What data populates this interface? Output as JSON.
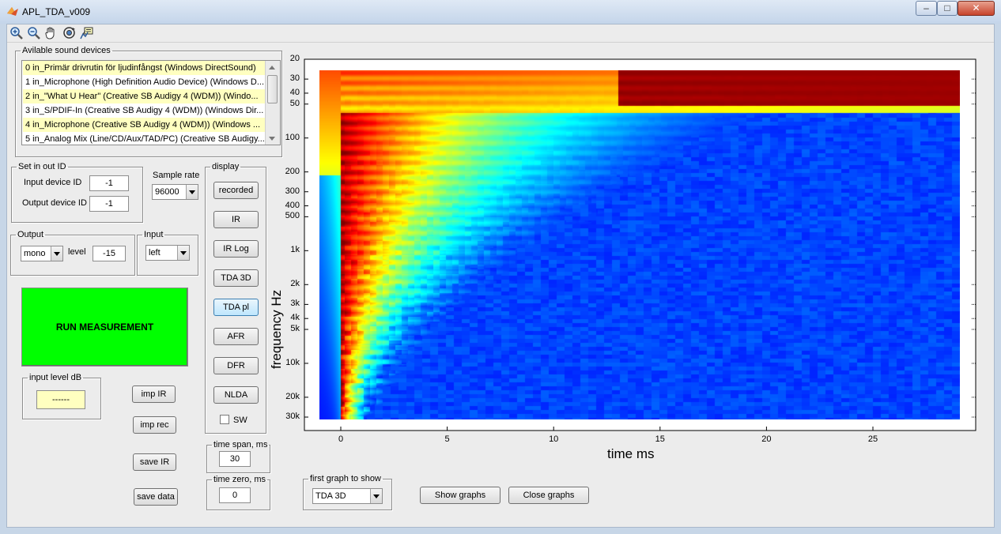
{
  "window": {
    "title": "APL_TDA_v009"
  },
  "toolbar": {
    "icons": [
      "zoom-in-icon",
      "zoom-out-icon",
      "pan-hand-icon",
      "rotate-3d-icon",
      "data-cursor-icon"
    ]
  },
  "devices": {
    "title": "Avilable sound devices",
    "items": [
      "0 in_Primär drivrutin för ljudinfångst (Windows DirectSound)",
      "1 in_Microphone (High Definition Audio Device) (Windows D...",
      "2 in_\"What U Hear\" (Creative SB Audigy 4 (WDM)) (Windo...",
      "3 in_S/PDIF-In (Creative SB Audigy 4 (WDM)) (Windows Dir...",
      "4 in_Microphone (Creative SB Audigy 4 (WDM)) (Windows ...",
      "5 in_Analog Mix (Line/CD/Aux/TAD/PC) (Creative SB Audigy..."
    ]
  },
  "set_io": {
    "title": "Set in out ID",
    "input_label": "Input device ID",
    "input_value": "-1",
    "output_label": "Output device ID",
    "output_value": "-1"
  },
  "sample_rate": {
    "label": "Sample rate",
    "value": "96000"
  },
  "output": {
    "title": "Output",
    "mode": "mono",
    "level_label": "level",
    "level_value": "-15"
  },
  "input": {
    "title": "Input",
    "channel": "left"
  },
  "run_button": "RUN MEASUREMENT",
  "input_level": {
    "title": "input level dB",
    "value": "------"
  },
  "action_buttons": {
    "imp_ir": "imp IR",
    "imp_rec": "imp rec",
    "save_ir": "save IR",
    "save_data": "save data"
  },
  "display": {
    "title": "display",
    "buttons": [
      "recorded",
      "IR",
      "IR Log",
      "TDA 3D",
      "TDA pl",
      "AFR",
      "DFR",
      "NLDA"
    ],
    "sw_label": "SW"
  },
  "time_span": {
    "title": "time span, ms",
    "value": "30"
  },
  "time_zero": {
    "title": "time zero, ms",
    "value": "0"
  },
  "first_graph": {
    "title": "first graph to show",
    "value": "TDA 3D"
  },
  "show_graphs": "Show graphs",
  "close_graphs": "Close graphs",
  "plot": {
    "type": "heatmap",
    "xlabel": "time   ms",
    "ylabel": "frequency   Hz",
    "x_ticks": [
      "0",
      "5",
      "10",
      "15",
      "20",
      "25"
    ],
    "y_ticks": [
      "20",
      "30",
      "40",
      "50",
      "100",
      "200",
      "300",
      "400",
      "500",
      "1k",
      "2k",
      "3k",
      "4k",
      "5k",
      "10k",
      "20k",
      "30k"
    ],
    "y_scale": "log",
    "colormap": "jet"
  },
  "colors": {
    "run_green": "#00ff00",
    "highlight_yellow": "#ffffc0"
  }
}
